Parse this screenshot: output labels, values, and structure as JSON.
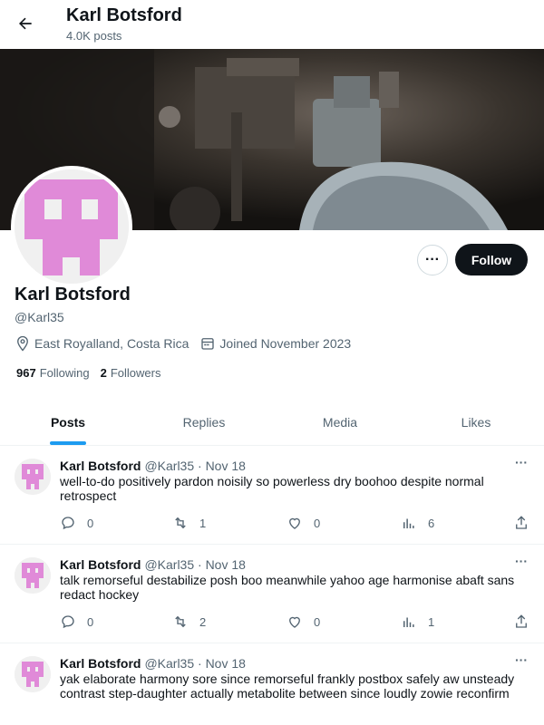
{
  "header": {
    "title": "Karl Botsford",
    "post_count": "4.0K posts"
  },
  "profile": {
    "name": "Karl Botsford",
    "handle": "@Karl35",
    "location": "East Royalland, Costa Rica",
    "joined": "Joined November 2023",
    "following_count": "967",
    "following_label": "Following",
    "followers_count": "2",
    "followers_label": "Followers",
    "follow_label": "Follow",
    "more_label": "···",
    "avatar_color": "#e08ad8"
  },
  "tabs": [
    {
      "label": "Posts",
      "active": true
    },
    {
      "label": "Replies",
      "active": false
    },
    {
      "label": "Media",
      "active": false
    },
    {
      "label": "Likes",
      "active": false
    }
  ],
  "posts": [
    {
      "name": "Karl Botsford",
      "handle": "@Karl35 · Nov 18",
      "text": "well-to-do positively pardon noisily so powerless dry boohoo despite normal retrospect",
      "replies": "0",
      "reposts": "1",
      "likes": "0",
      "views": "6"
    },
    {
      "name": "Karl Botsford",
      "handle": "@Karl35 · Nov 18",
      "text": "talk remorseful destabilize posh boo meanwhile yahoo age harmonise abaft sans redact hockey",
      "replies": "0",
      "reposts": "2",
      "likes": "0",
      "views": "1"
    },
    {
      "name": "Karl Botsford",
      "handle": "@Karl35 · Nov 18",
      "text": "yak elaborate harmony sore since remorseful frankly postbox safely aw unsteady contrast step-daughter actually metabolite between since loudly zowie reconfirm",
      "replies": "",
      "reposts": "",
      "likes": "",
      "views": ""
    }
  ],
  "icons": {
    "back": "arrow-left-icon",
    "location": "location-pin-icon",
    "calendar": "calendar-icon",
    "reply": "reply-icon",
    "repost": "repost-icon",
    "like": "heart-icon",
    "views": "views-icon",
    "share": "share-icon"
  }
}
